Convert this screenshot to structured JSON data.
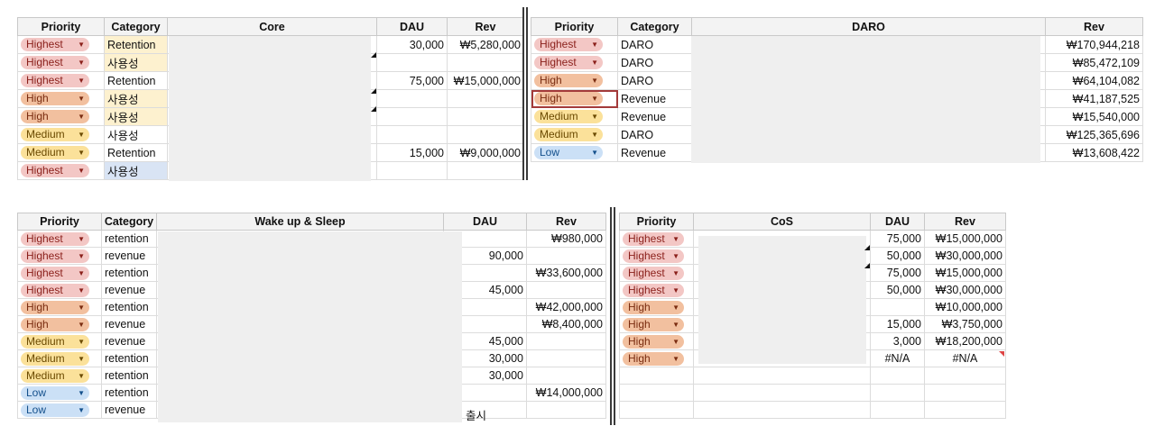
{
  "core": {
    "headers": [
      "Priority",
      "Category",
      "Core",
      "DAU",
      "Rev"
    ],
    "rows": [
      {
        "priority": "Highest",
        "category": "Retention",
        "dau": "30,000",
        "rev": "₩5,280,000"
      },
      {
        "priority": "Highest",
        "category": "사용성",
        "dau": "",
        "rev": ""
      },
      {
        "priority": "Highest",
        "category": "Retention",
        "dau": "75,000",
        "rev": "₩15,000,000"
      },
      {
        "priority": "High",
        "category": "사용성",
        "dau": "",
        "rev": ""
      },
      {
        "priority": "High",
        "category": "사용성",
        "dau": "",
        "rev": ""
      },
      {
        "priority": "Medium",
        "category": "사용성",
        "dau": "",
        "rev": ""
      },
      {
        "priority": "Medium",
        "category": "Retention",
        "dau": "15,000",
        "rev": "₩9,000,000"
      },
      {
        "priority": "Highest",
        "category": "사용성",
        "dau": "",
        "rev": ""
      }
    ]
  },
  "daro": {
    "headers": [
      "Priority",
      "Category",
      "DARO",
      "Rev"
    ],
    "rows": [
      {
        "priority": "Highest",
        "category": "DARO",
        "rev": "₩170,944,218"
      },
      {
        "priority": "Highest",
        "category": "DARO",
        "rev": "₩85,472,109"
      },
      {
        "priority": "High",
        "category": "DARO",
        "rev": "₩64,104,082"
      },
      {
        "priority": "High",
        "category": "Revenue",
        "rev": "₩41,187,525"
      },
      {
        "priority": "Medium",
        "category": "Revenue",
        "rev": "₩15,540,000"
      },
      {
        "priority": "Medium",
        "category": "DARO",
        "rev": "₩125,365,696"
      },
      {
        "priority": "Low",
        "category": "Revenue",
        "rev": "₩13,608,422"
      }
    ]
  },
  "wake": {
    "headers": [
      "Priority",
      "Category",
      "Wake up & Sleep",
      "DAU",
      "Rev"
    ],
    "overflow_text": "출시",
    "rows": [
      {
        "priority": "Highest",
        "category": "retention",
        "dau": "",
        "rev": "₩980,000"
      },
      {
        "priority": "Highest",
        "category": "revenue",
        "dau": "90,000",
        "rev": ""
      },
      {
        "priority": "Highest",
        "category": "retention",
        "dau": "",
        "rev": "₩33,600,000"
      },
      {
        "priority": "Highest",
        "category": "revenue",
        "dau": "45,000",
        "rev": ""
      },
      {
        "priority": "High",
        "category": "retention",
        "dau": "",
        "rev": "₩42,000,000"
      },
      {
        "priority": "High",
        "category": "revenue",
        "dau": "",
        "rev": "₩8,400,000"
      },
      {
        "priority": "Medium",
        "category": "revenue",
        "dau": "45,000",
        "rev": ""
      },
      {
        "priority": "Medium",
        "category": "retention",
        "dau": "30,000",
        "rev": ""
      },
      {
        "priority": "Medium",
        "category": "retention",
        "dau": "30,000",
        "rev": ""
      },
      {
        "priority": "Low",
        "category": "retention",
        "dau": "",
        "rev": "₩14,000,000"
      },
      {
        "priority": "Low",
        "category": "revenue",
        "dau": "",
        "rev": ""
      }
    ]
  },
  "cos": {
    "headers": [
      "Priority",
      "CoS",
      "DAU",
      "Rev"
    ],
    "rows": [
      {
        "priority": "Highest",
        "dau": "75,000",
        "rev": "₩15,000,000"
      },
      {
        "priority": "Highest",
        "dau": "50,000",
        "rev": "₩30,000,000"
      },
      {
        "priority": "Highest",
        "dau": "75,000",
        "rev": "₩15,000,000"
      },
      {
        "priority": "Highest",
        "dau": "50,000",
        "rev": "₩30,000,000"
      },
      {
        "priority": "High",
        "dau": "",
        "rev": "₩10,000,000"
      },
      {
        "priority": "High",
        "dau": "15,000",
        "rev": "₩3,750,000"
      },
      {
        "priority": "High",
        "dau": "3,000",
        "rev": "₩18,200,000"
      },
      {
        "priority": "High",
        "dau": "#N/A",
        "rev": "#N/A"
      },
      {
        "priority": "",
        "dau": "",
        "rev": ""
      },
      {
        "priority": "",
        "dau": "",
        "rev": ""
      },
      {
        "priority": "",
        "dau": "",
        "rev": ""
      }
    ]
  },
  "colors": {
    "highest_chip": "#f3c7c5",
    "high_chip": "#f2c09f",
    "medium_chip": "#fbe19a",
    "low_chip": "#cbe0f6",
    "selection_border": "#a33a3a",
    "highlight_yellow": "#fdf1cf",
    "highlight_blue": "#d9e4f4",
    "redaction": "#efefef"
  },
  "icons": {
    "dropdown": "triangle-down-icon"
  }
}
